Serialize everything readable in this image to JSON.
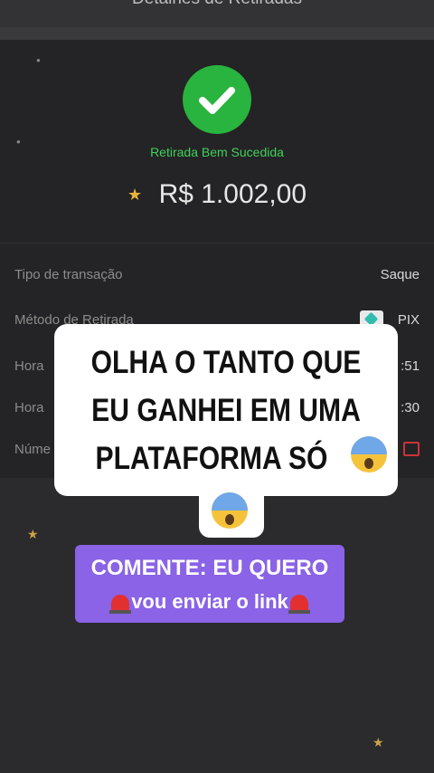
{
  "header": {
    "title": "Detalhes de Retiradas"
  },
  "receipt": {
    "status": "Retirada Bem Sucedida",
    "amount": "R$ 1.002,00",
    "rows": [
      {
        "label": "Tipo de transação",
        "value": "Saque"
      },
      {
        "label": "Método de Retirada",
        "value": "PIX"
      },
      {
        "label": "Hora",
        "value": ":51"
      },
      {
        "label": "Hora",
        "value": ":30"
      },
      {
        "label": "Núme",
        "value": ""
      }
    ]
  },
  "overlay": {
    "callout_lines": [
      "OLHA O TANTO QUE",
      "EU GANHEI EM UMA",
      "PLATAFORMA SÓ"
    ],
    "cta_line1": "COMENTE: EU QUERO",
    "cta_line2": "vou enviar o link"
  },
  "icons": [
    "check-icon",
    "star-icon",
    "pix-icon",
    "copy-icon",
    "screaming-face-emoji",
    "siren-emoji"
  ],
  "colors": {
    "success": "#29b33f",
    "cta": "#8a63e6",
    "background": "#2b2a2c"
  }
}
